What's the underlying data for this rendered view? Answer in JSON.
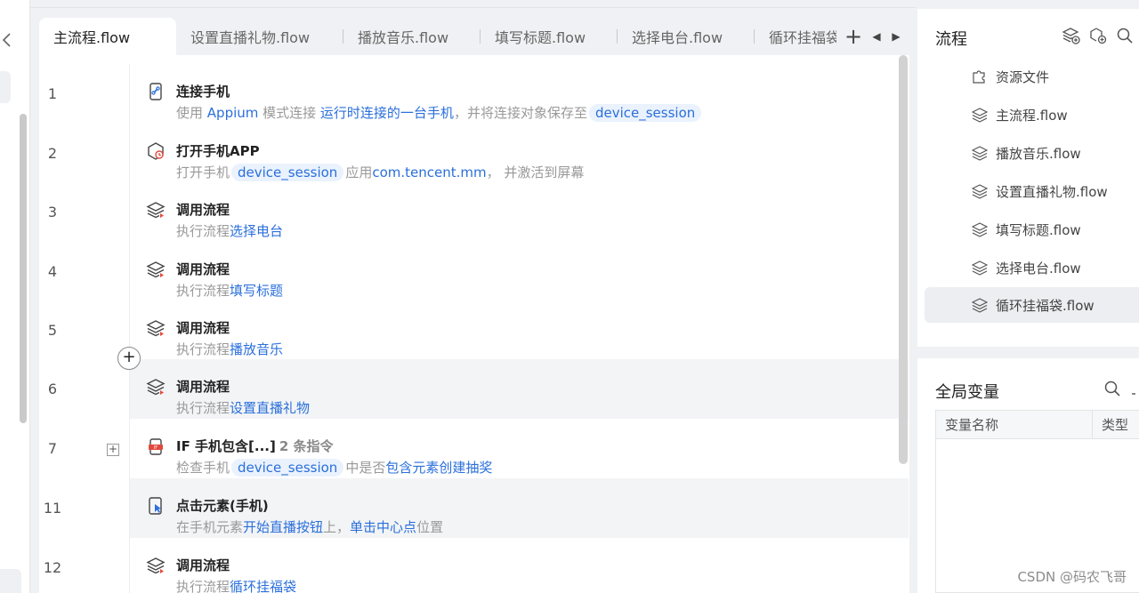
{
  "tabs": [
    {
      "label": "主流程.flow",
      "active": true
    },
    {
      "label": "设置直播礼物.flow",
      "active": false
    },
    {
      "label": "播放音乐.flow",
      "active": false
    },
    {
      "label": "填写标题.flow",
      "active": false
    },
    {
      "label": "选择电台.flow",
      "active": false
    },
    {
      "label": "循环挂福袋.flow",
      "active": false
    }
  ],
  "tab_tools": {
    "add": "+",
    "prev": "◀",
    "next": "▶"
  },
  "steps": [
    {
      "line": "1",
      "title": "连接手机",
      "icon": "link-phone-icon",
      "d1": "使用 ",
      "h1": "Appium",
      "d2": " 模式连接 ",
      "h2": "运行时连接的一台手机",
      "d3": "，并将连接对象保存至",
      "chip": "device_session"
    },
    {
      "line": "2",
      "title": "打开手机APP",
      "icon": "open-app-icon",
      "d1": "打开手机",
      "chip": "device_session",
      "d2": "应用",
      "h1": "com.tencent.mm",
      "d3": "， 并激活到屏幕"
    },
    {
      "line": "3",
      "title": "调用流程",
      "icon": "call-flow-icon",
      "d1": "执行流程",
      "h1": "选择电台"
    },
    {
      "line": "4",
      "title": "调用流程",
      "icon": "call-flow-icon",
      "d1": "执行流程",
      "h1": "填写标题"
    },
    {
      "line": "5",
      "title": "调用流程",
      "icon": "call-flow-icon",
      "d1": "执行流程",
      "h1": "播放音乐"
    },
    {
      "line": "6",
      "title": "调用流程",
      "icon": "call-flow-icon",
      "d1": "执行流程",
      "h1": "设置直播礼物"
    },
    {
      "line": "7",
      "title": "IF 手机包含[...]",
      "count": "2 条指令",
      "icon": "if-phone-icon",
      "d1": "检查手机",
      "chip": "device_session",
      "d2": "中是否",
      "h1": "包含元素创建抽奖"
    },
    {
      "line": "11",
      "title": "点击元素(手机)",
      "icon": "tap-element-icon",
      "d1": "在手机元素",
      "h1": "开始直播按钮",
      "d2": "上，",
      "h2": "单击中心点",
      "d3": "位置"
    },
    {
      "line": "12",
      "title": "调用流程",
      "icon": "call-flow-icon",
      "d1": "执行流程",
      "h1": "循环挂福袋"
    }
  ],
  "add_step": "+",
  "expand": "+",
  "flow_panel": {
    "title": "流程",
    "items": [
      {
        "label": "资源文件",
        "icon": "puzzle-icon"
      },
      {
        "label": "主流程.flow",
        "icon": "layers-icon"
      },
      {
        "label": "播放音乐.flow",
        "icon": "layers-icon"
      },
      {
        "label": "设置直播礼物.flow",
        "icon": "layers-icon"
      },
      {
        "label": "填写标题.flow",
        "icon": "layers-icon"
      },
      {
        "label": "选择电台.flow",
        "icon": "layers-icon"
      },
      {
        "label": "循环挂福袋.flow",
        "icon": "layers-icon",
        "selected": true
      }
    ]
  },
  "var_panel": {
    "title": "全局变量",
    "col_name": "变量名称",
    "col_type": "类型"
  },
  "watermark": "CSDN @码农飞哥",
  "colors": {
    "accent": "#2a6fdb",
    "chip_bg": "#eaf2fd",
    "highlight_row": "#f3f4f6"
  }
}
